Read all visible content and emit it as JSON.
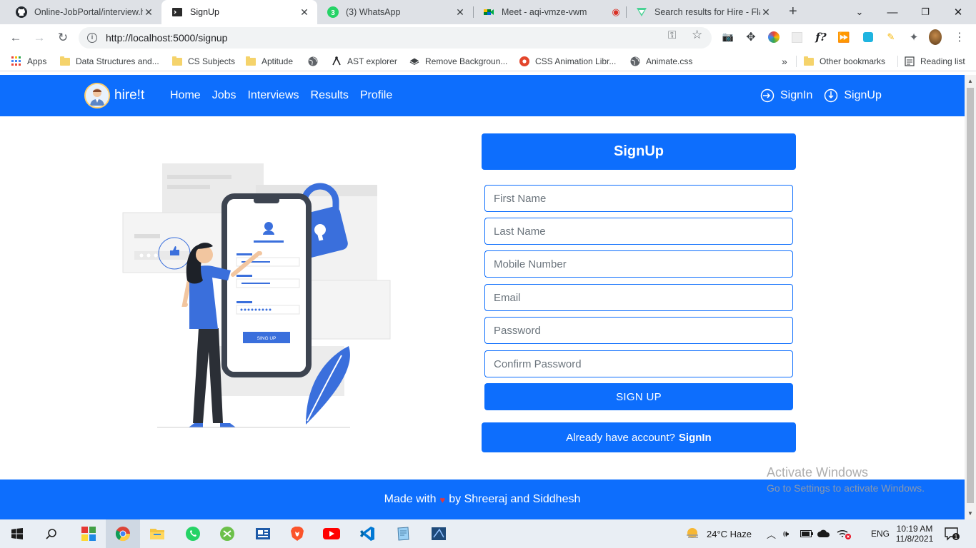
{
  "browser": {
    "tabs": [
      {
        "title": "Online-JobPortal/interview.h",
        "icon": "github-icon",
        "active": false
      },
      {
        "title": "SignUp",
        "icon": "terminal-icon",
        "active": true
      },
      {
        "title": "(3) WhatsApp",
        "icon": "whatsapp-icon",
        "badge": "3",
        "active": false
      },
      {
        "title": "Meet - aqi-vmze-vwm",
        "icon": "meet-icon",
        "active": false
      },
      {
        "title": "Search results for Hire - Flat",
        "icon": "flaticon-icon",
        "active": false
      }
    ],
    "url": "http://localhost:5000/signup",
    "bookmarks": [
      {
        "label": "Apps",
        "icon": "apps-grid-icon"
      },
      {
        "label": "Data Structures and...",
        "icon": "folder-icon"
      },
      {
        "label": "CS Subjects",
        "icon": "folder-icon"
      },
      {
        "label": "Aptitude",
        "icon": "folder-icon"
      },
      {
        "label": "",
        "icon": "globe-icon"
      },
      {
        "label": "AST explorer",
        "icon": "ast-icon"
      },
      {
        "label": "Remove Backgroun...",
        "icon": "layers-icon"
      },
      {
        "label": "CSS Animation Libr...",
        "icon": "css-icon"
      },
      {
        "label": "Animate.css",
        "icon": "globe-icon"
      }
    ],
    "overflow": "»",
    "other_bookmarks": "Other bookmarks",
    "reading_list": "Reading list"
  },
  "page": {
    "brand": "hire!t",
    "nav": [
      "Home",
      "Jobs",
      "Interviews",
      "Results",
      "Profile"
    ],
    "signin_label": "SignIn",
    "signup_label": "SignUp",
    "form": {
      "heading": "SignUp",
      "first_name_placeholder": "First Name",
      "last_name_placeholder": "Last Name",
      "mobile_placeholder": "Mobile Number",
      "email_placeholder": "Email",
      "password_placeholder": "Password",
      "confirm_placeholder": "Confirm Password",
      "submit_label": "SIGN UP",
      "already_text": "Already have account?",
      "already_link": "SignIn"
    },
    "illustration": {
      "button_text": "SING UP"
    },
    "footer": {
      "prefix": "Made with",
      "suffix": "by Shreeraj and Siddhesh"
    }
  },
  "watermark": {
    "line1": "Activate Windows",
    "line2": "Go to Settings to activate Windows."
  },
  "taskbar": {
    "weather": "24°C  Haze",
    "lang": "ENG",
    "time": "10:19 AM",
    "date": "11/8/2021",
    "notifications": "1"
  },
  "colors": {
    "primary": "#0d6efd",
    "heart": "#e5383b"
  }
}
